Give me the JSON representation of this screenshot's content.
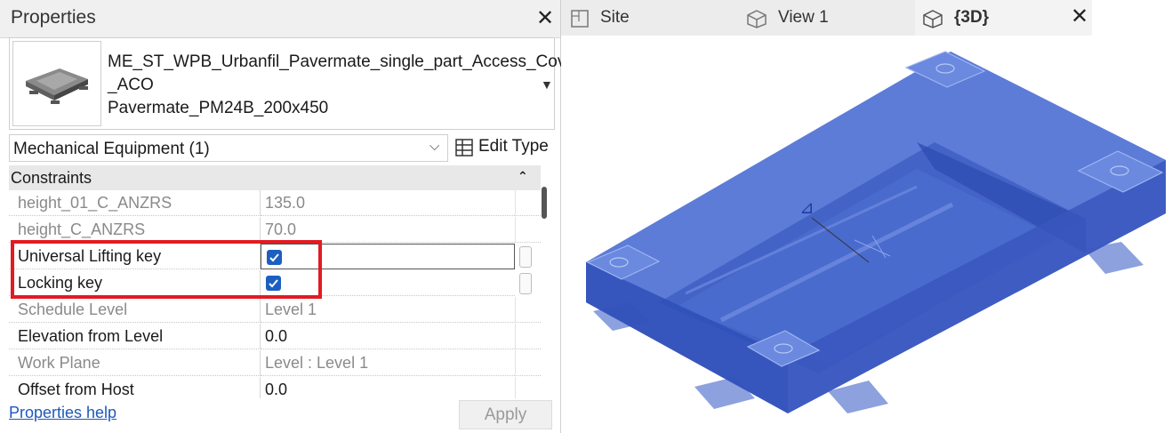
{
  "properties": {
    "title": "Properties",
    "type_name_lines": [
      "ME_ST_WPB_Urbanfil_Pavermate_single_part_Access_Cover",
      "_ACO",
      "Pavermate_PM24B_200x450"
    ],
    "category_selector": "Mechanical Equipment (1)",
    "edit_type": "Edit Type",
    "section": "Constraints",
    "rows": [
      {
        "label": "height_01_C_ANZRS",
        "value": "135.0"
      },
      {
        "label": "height_C_ANZRS",
        "value": "70.0"
      },
      {
        "label": "Universal Lifting key",
        "checked": true
      },
      {
        "label": "Locking key",
        "checked": true
      },
      {
        "label": "Schedule Level",
        "value": "Level 1"
      },
      {
        "label": "Elevation from Level",
        "value": "0.0"
      },
      {
        "label": "Work Plane",
        "value": "Level : Level 1"
      },
      {
        "label": "Offset from Host",
        "value": "0.0"
      }
    ],
    "help_link": "Properties help",
    "apply": "Apply"
  },
  "view_tabs": [
    {
      "label": "Site",
      "icon": "site-view-icon"
    },
    {
      "label": "View 1",
      "icon": "3d-house-icon"
    },
    {
      "label": "{3D}",
      "icon": "3d-house-icon",
      "active": true
    }
  ],
  "colors": {
    "accent_checkbox": "#1c5fc1",
    "highlight_box": "#e11b22",
    "model_fill": "#3d5fc2",
    "link": "#1f59b8"
  }
}
